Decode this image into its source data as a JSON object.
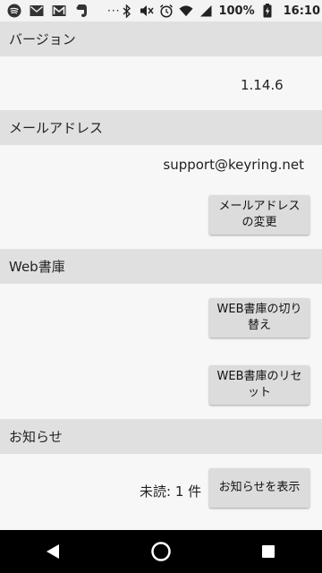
{
  "status_bar": {
    "battery_percent": "100%",
    "time": "16:10",
    "notification_icons": [
      "spotify-icon",
      "mail-icon",
      "gmail-icon",
      "evernote-icon"
    ],
    "overflow": "···",
    "system_icons": [
      "bluetooth-icon",
      "mute-icon",
      "alarm-icon",
      "wifi-icon",
      "signal-icon",
      "battery-icon"
    ]
  },
  "sections": {
    "version": {
      "header": "バージョン",
      "value": "1.14.6"
    },
    "email": {
      "header": "メールアドレス",
      "value": "support@keyring.net",
      "button": "メールアドレスの変更"
    },
    "web_library": {
      "header": "Web書庫",
      "switch_button": "WEB書庫の切り替え",
      "reset_button": "WEB書庫のリセット"
    },
    "notices": {
      "header": "お知らせ",
      "unread_label": "未読: 1 件",
      "button": "お知らせを表示"
    }
  },
  "nav": {
    "buttons": [
      "back",
      "home",
      "recents"
    ]
  }
}
